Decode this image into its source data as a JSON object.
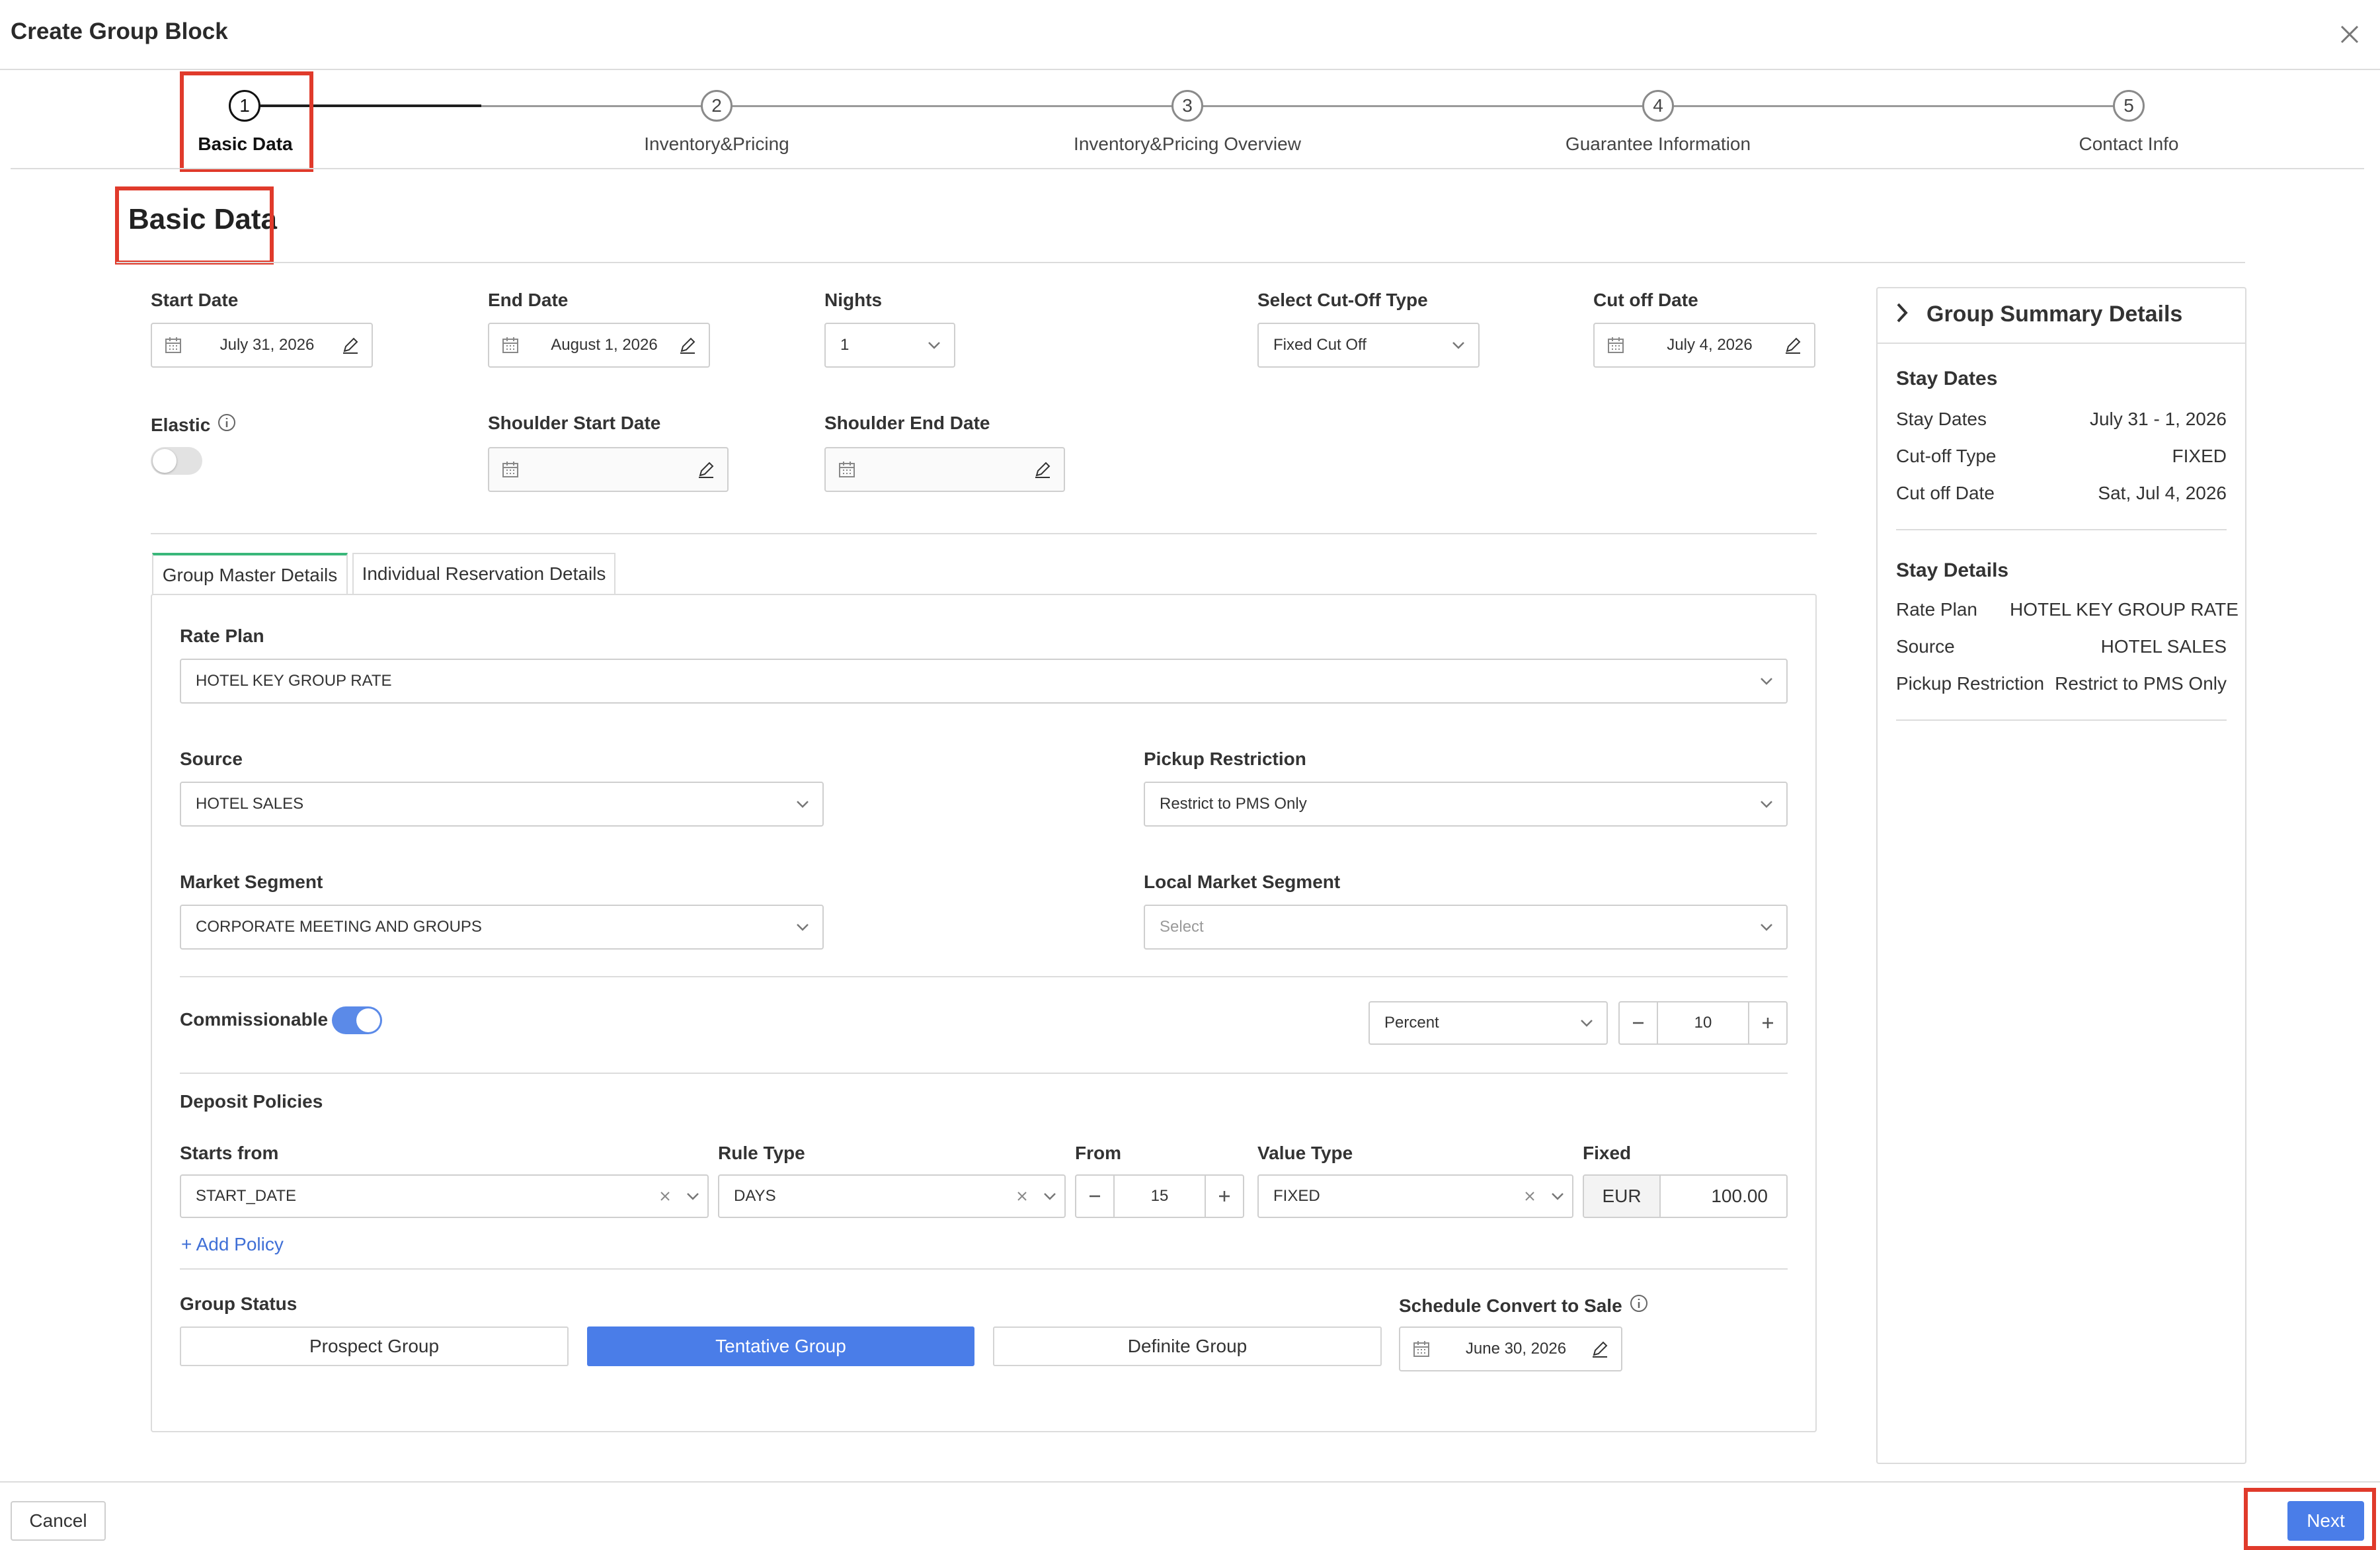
{
  "window": {
    "title": "Create Group Block"
  },
  "steps": [
    {
      "num": "1",
      "label": "Basic Data",
      "active": true
    },
    {
      "num": "2",
      "label": "Inventory&Pricing",
      "active": false
    },
    {
      "num": "3",
      "label": "Inventory&Pricing Overview",
      "active": false
    },
    {
      "num": "4",
      "label": "Guarantee Information",
      "active": false
    },
    {
      "num": "5",
      "label": "Contact Info",
      "active": false
    }
  ],
  "section_title": "Basic Data",
  "basic": {
    "start_date": {
      "label": "Start Date",
      "value": "July 31, 2026"
    },
    "end_date": {
      "label": "End Date",
      "value": "August 1, 2026"
    },
    "nights": {
      "label": "Nights",
      "value": "1"
    },
    "cutoff_type": {
      "label": "Select Cut-Off Type",
      "value": "Fixed Cut Off"
    },
    "cutoff_date": {
      "label": "Cut off Date",
      "value": "July 4, 2026"
    },
    "elastic": {
      "label": "Elastic",
      "on": false
    },
    "shoulder_start": {
      "label": "Shoulder Start Date",
      "value": ""
    },
    "shoulder_end": {
      "label": "Shoulder End Date",
      "value": ""
    }
  },
  "tabs": [
    {
      "label": "Group Master Details",
      "active": true
    },
    {
      "label": "Individual Reservation Details",
      "active": false
    }
  ],
  "master": {
    "rate_plan": {
      "label": "Rate Plan",
      "value": "HOTEL KEY GROUP RATE"
    },
    "source": {
      "label": "Source",
      "value": "HOTEL SALES"
    },
    "pickup": {
      "label": "Pickup Restriction",
      "value": "Restrict to PMS Only"
    },
    "market_segment": {
      "label": "Market Segment",
      "value": "CORPORATE MEETING AND GROUPS"
    },
    "local_market": {
      "label": "Local Market Segment",
      "placeholder": "Select"
    },
    "commissionable": {
      "label": "Commissionable",
      "on": true,
      "type": "Percent",
      "amount": "10"
    },
    "deposit": {
      "title": "Deposit Policies",
      "starts_from": {
        "label": "Starts from",
        "value": "START_DATE"
      },
      "rule_type": {
        "label": "Rule Type",
        "value": "DAYS"
      },
      "from": {
        "label": "From",
        "value": "15"
      },
      "value_type": {
        "label": "Value Type",
        "value": "FIXED"
      },
      "fixed": {
        "label": "Fixed",
        "currency": "EUR",
        "amount": "100.00"
      },
      "add_policy": "+ Add Policy"
    },
    "group_status": {
      "label": "Group Status",
      "options": [
        "Prospect Group",
        "Tentative Group",
        "Definite Group"
      ],
      "selected": "Tentative Group"
    },
    "convert": {
      "label": "Schedule Convert to Sale",
      "value": "June 30, 2026"
    }
  },
  "summary": {
    "title": "Group Summary Details",
    "stay_dates": {
      "heading": "Stay Dates",
      "rows": [
        {
          "k": "Stay Dates",
          "v": "July 31 - 1, 2026"
        },
        {
          "k": "Cut-off Type",
          "v": "FIXED"
        },
        {
          "k": "Cut off Date",
          "v": "Sat, Jul 4, 2026"
        }
      ]
    },
    "stay_details": {
      "heading": "Stay Details",
      "rows": [
        {
          "k": "Rate Plan",
          "v": "HOTEL KEY GROUP RATE"
        },
        {
          "k": "Source",
          "v": "HOTEL SALES"
        },
        {
          "k": "Pickup Restriction",
          "v": "Restrict to PMS Only"
        }
      ]
    }
  },
  "footer": {
    "cancel": "Cancel",
    "next": "Next"
  },
  "colors": {
    "accent": "#4a7de8",
    "highlight": "#e03a2b",
    "tab_active": "#3ab77a"
  }
}
